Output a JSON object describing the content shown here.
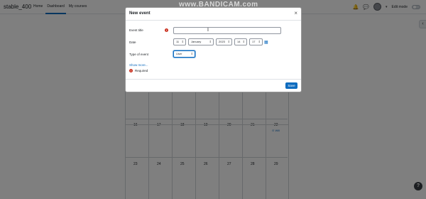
{
  "navbar": {
    "brand": "stable_400",
    "links": [
      "Home",
      "Dashboard",
      "My courses"
    ],
    "edit_mode_label": "Edit mode"
  },
  "watermark": "www.BANDICAM.com",
  "calendar": {
    "week1": [
      "16",
      "17",
      "18",
      "19",
      "20",
      "21",
      "22"
    ],
    "week2": [
      "23",
      "24",
      "25",
      "26",
      "27",
      "28",
      "29"
    ],
    "event_label": "Will"
  },
  "modal": {
    "title": "New event",
    "close_glyph": "×",
    "event_title_label": "Event title",
    "event_title_value": "",
    "date_label": "Date",
    "date": {
      "day": "11",
      "month": "January",
      "year": "2023",
      "hour": "14",
      "minute": "17"
    },
    "type_label": "Type of event",
    "type_value": "User",
    "show_more": "Show more...",
    "required_text": "Required",
    "save_label": "Save"
  },
  "icons": {
    "required": "exclamation-circle-icon",
    "calendar": "calendar-icon",
    "close": "close-icon"
  },
  "colors": {
    "primary": "#0f6cbf",
    "required": "#ca3120",
    "backdrop": "rgba(0,0,0,0.5)"
  }
}
